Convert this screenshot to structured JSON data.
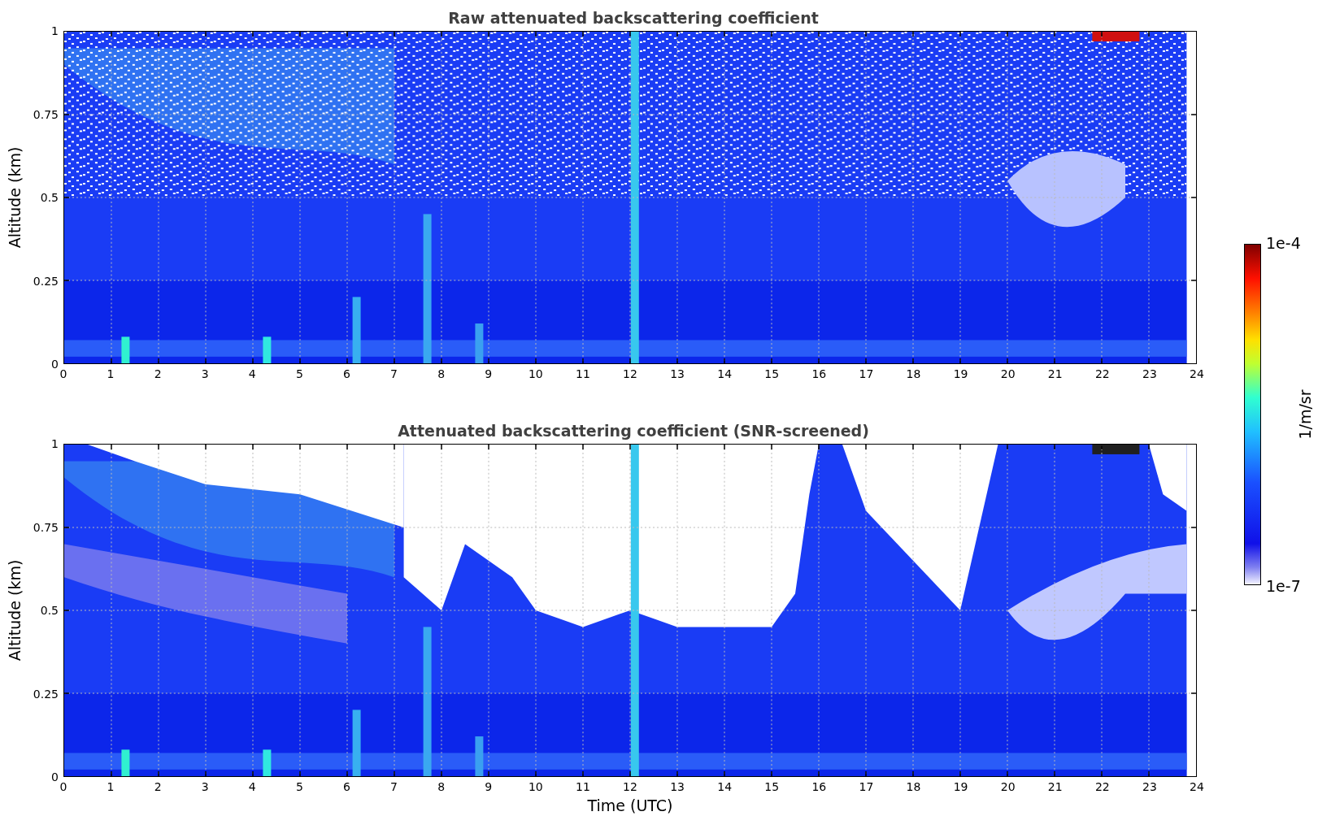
{
  "panels": [
    {
      "kind": "raw",
      "title": "Raw attenuated backscattering coefficient",
      "ylabel": "Altitude (km)",
      "yticks": [
        "1",
        "0.75",
        "0.5",
        "0.25",
        "0"
      ],
      "xticks": [
        "0",
        "1",
        "2",
        "3",
        "4",
        "5",
        "6",
        "7",
        "8",
        "9",
        "10",
        "11",
        "12",
        "13",
        "14",
        "15",
        "16",
        "17",
        "18",
        "19",
        "20",
        "21",
        "22",
        "23",
        "24"
      ]
    },
    {
      "kind": "screened",
      "title": "Attenuated backscattering coefficient (SNR-screened)",
      "ylabel": "Altitude (km)",
      "yticks": [
        "1",
        "0.75",
        "0.5",
        "0.25",
        "0"
      ],
      "xticks": [
        "0",
        "1",
        "2",
        "3",
        "4",
        "5",
        "6",
        "7",
        "8",
        "9",
        "10",
        "11",
        "12",
        "13",
        "14",
        "15",
        "16",
        "17",
        "18",
        "19",
        "20",
        "21",
        "22",
        "23",
        "24"
      ],
      "xlabel": "Time (UTC)"
    }
  ],
  "colorbar": {
    "max": "1e-4",
    "min": "1e-7",
    "label": "1/m/sr"
  }
}
